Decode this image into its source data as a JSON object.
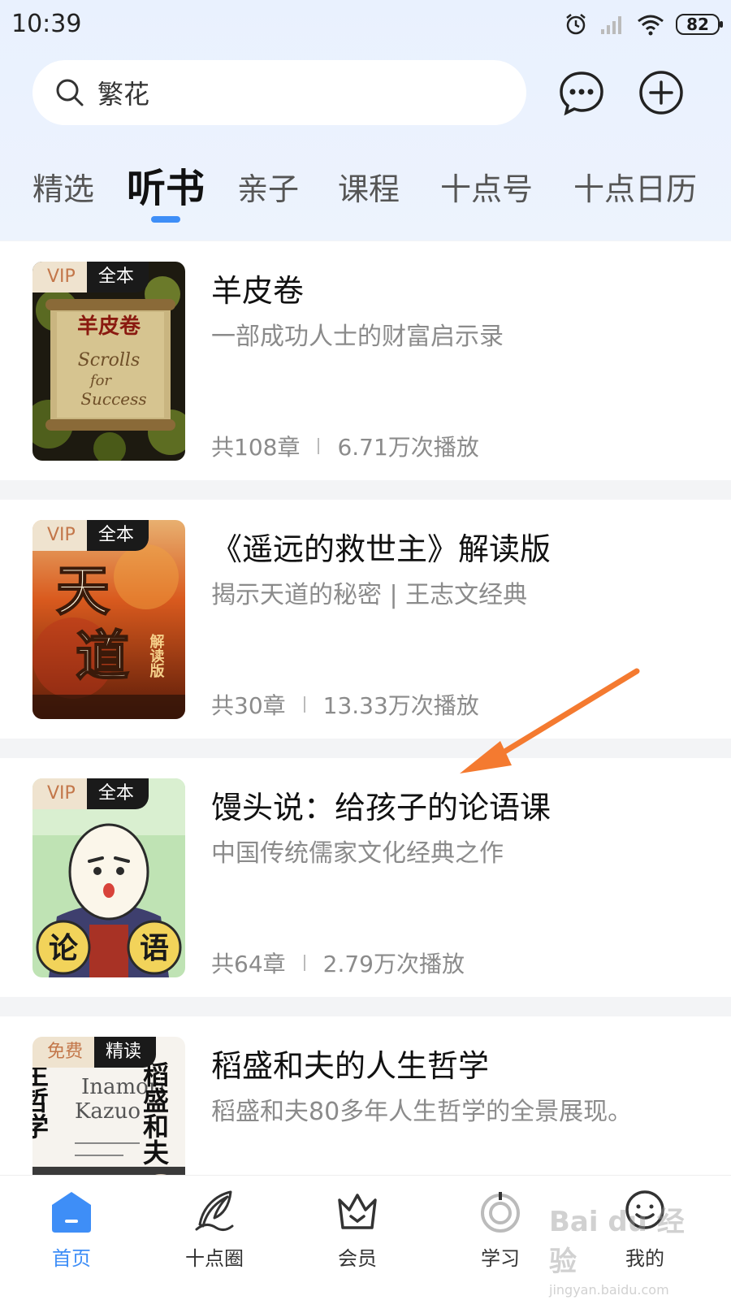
{
  "status_bar": {
    "time": "10:39",
    "battery": "82"
  },
  "search": {
    "text": "繁花"
  },
  "tabs": [
    "精选",
    "听书",
    "亲子",
    "课程",
    "十点号",
    "十点日历"
  ],
  "books": [
    {
      "badge_left": "VIP",
      "badge_right": "全本",
      "title": "羊皮卷",
      "desc": "一部成功人士的财富启示录",
      "chapters": "共108章",
      "plays": "6.71万次播放",
      "cover": {
        "name": "scroll-cover",
        "text1": "羊皮卷",
        "text2": "Scrolls",
        "text3": "for",
        "text4": "Success"
      }
    },
    {
      "badge_left": "VIP",
      "badge_right": "全本",
      "title": "《遥远的救世主》解读版",
      "desc": "揭示天道的秘密 | 王志文经典",
      "chapters": "共30章",
      "plays": "13.33万次播放",
      "cover": {
        "name": "tiandao-cover",
        "text1": "天",
        "text2": "道",
        "text3": "解读版"
      }
    },
    {
      "badge_left": "VIP",
      "badge_right": "全本",
      "title": "馒头说：给孩子的论语课",
      "desc": "中国传统儒家文化经典之作",
      "chapters": "共64章",
      "plays": "2.79万次播放",
      "cover": {
        "name": "lunyu-cover",
        "text1": "论",
        "text2": "语"
      }
    },
    {
      "badge_left": "免费",
      "badge_right": "精读",
      "title": "稻盛和夫的人生哲学",
      "desc": "稻盛和夫80多年人生哲学的全景展现。",
      "cover": {
        "name": "inamori-cover",
        "text1": "稻盛和夫",
        "text2": "Inamori",
        "text3": "Kazuo",
        "text4": "生哲学"
      }
    }
  ],
  "bottom_nav": [
    {
      "label": "首页",
      "icon": "home-icon",
      "active": true
    },
    {
      "label": "十点圈",
      "icon": "feather-icon",
      "active": false
    },
    {
      "label": "会员",
      "icon": "crown-icon",
      "active": false
    },
    {
      "label": "学习",
      "icon": "learn-icon",
      "active": false
    },
    {
      "label": "我的",
      "icon": "profile-icon",
      "active": false
    }
  ],
  "watermark": {
    "line1": "Bai du 经验",
    "line2": "jingyan.baidu.com"
  },
  "colors": {
    "accent": "#3e8ef7",
    "arrow": "#f47a30",
    "vip_badge": "#efe3cf"
  }
}
